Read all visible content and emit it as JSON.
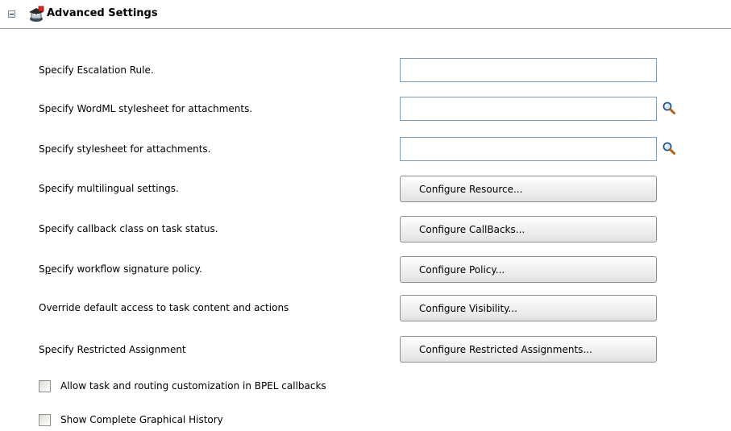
{
  "section": {
    "title": "Advanced Settings",
    "collapse_icon": "minus-collapse-icon",
    "icon": "settings-wizard-icon"
  },
  "rows": {
    "escalation": {
      "label": "Specify Escalation Rule.",
      "value": ""
    },
    "wordml": {
      "label": "Specify WordML stylesheet for attachments.",
      "value": "",
      "icon": "search-icon"
    },
    "stylesheet": {
      "label": "Specify stylesheet for attachments.",
      "value": "",
      "icon": "search-icon"
    },
    "multilingual": {
      "label": "Specify multilingual settings.",
      "button": "Configure Resource..."
    },
    "callback": {
      "label": "Specify callback class on task status.",
      "button": "Configure CallBacks..."
    },
    "signature": {
      "label_before": "S",
      "label_mnemonic": "p",
      "label_after": "ecify workflow signature policy.",
      "button": "Configure Policy..."
    },
    "visibility": {
      "label": "Override default access to task content and actions",
      "button": "Configure Visibility..."
    },
    "restricted": {
      "label": "Specify Restricted Assignment",
      "button": "Configure Restricted Assignments..."
    }
  },
  "checkboxes": {
    "bpel_callbacks": {
      "label": "Allow task and routing customization in BPEL callbacks",
      "checked": false
    },
    "graphical_history": {
      "label": "Show Complete Graphical History",
      "checked": false
    }
  },
  "colors": {
    "field_border": "#7f9db9",
    "header_rule": "#a3a3a3",
    "button_border": "#8d8d8d"
  }
}
